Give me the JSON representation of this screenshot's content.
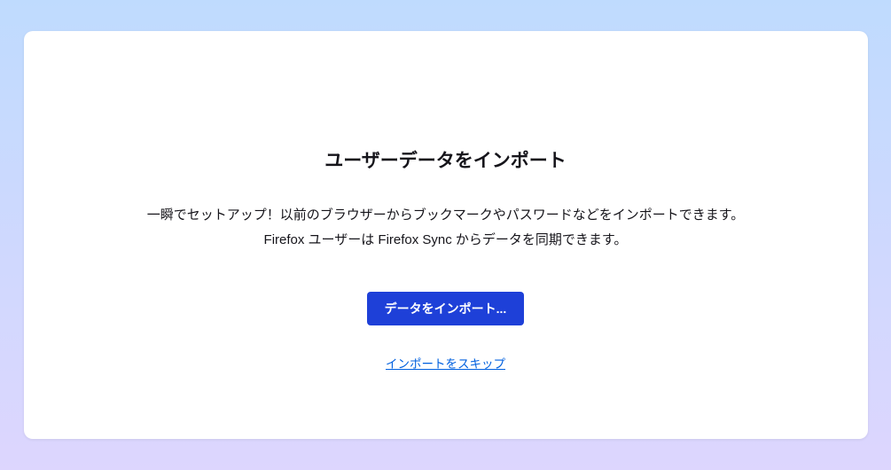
{
  "dialog": {
    "heading": "ユーザーデータをインポート",
    "description_line1": "一瞬でセットアップ！以前のブラウザーからブックマークやパスワードなどをインポートできます。",
    "description_line2": "Firefox ユーザーは Firefox Sync からデータを同期できます。",
    "import_button_label": "データをインポート...",
    "skip_link_label": "インポートをスキップ"
  }
}
